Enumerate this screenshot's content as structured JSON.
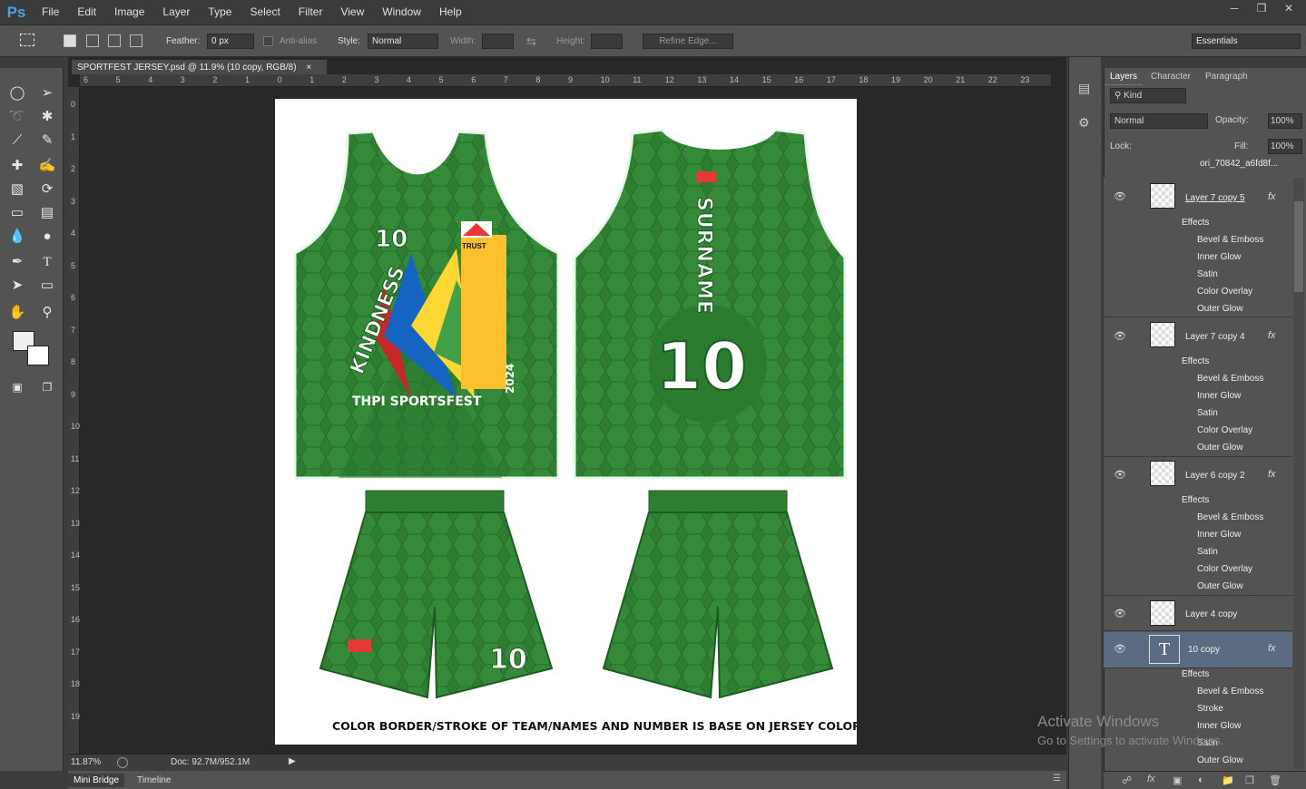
{
  "app": {
    "logo": "Ps"
  },
  "menu": [
    "File",
    "Edit",
    "Image",
    "Layer",
    "Type",
    "Select",
    "Filter",
    "View",
    "Window",
    "Help"
  ],
  "window_controls": [
    "minimize",
    "restore",
    "close"
  ],
  "options": {
    "feather_label": "Feather:",
    "feather_value": "0 px",
    "antialias_label": "Anti-alias",
    "style_label": "Style:",
    "style_value": "Normal",
    "width_label": "Width:",
    "height_label": "Height:",
    "refine_label": "Refine Edge...",
    "workspace": "Essentials"
  },
  "document": {
    "tab_title": "SPORTFEST JERSEY.psd @ 11.9% (10 copy, RGB/8)",
    "zoom": "11.87%",
    "doc_size": "Doc: 92.7M/952.1M",
    "ruler_h": [
      "6",
      "5",
      "4",
      "3",
      "2",
      "1",
      "0",
      "1",
      "2",
      "3",
      "4",
      "5",
      "6",
      "7",
      "8",
      "9",
      "10",
      "11",
      "12",
      "13",
      "14",
      "15",
      "16",
      "17",
      "18",
      "19",
      "20",
      "21",
      "22",
      "23"
    ],
    "ruler_v": [
      "0",
      "1",
      "2",
      "3",
      "4",
      "5",
      "6",
      "7",
      "8",
      "9",
      "10",
      "11",
      "12",
      "13",
      "14",
      "15",
      "16",
      "17",
      "18",
      "19"
    ]
  },
  "artwork": {
    "front_number": "10",
    "logo_text": "TRUST",
    "kindness": "KINDNESS",
    "event": "THPI SPORTSFEST",
    "year": "2024",
    "surname": "SURNAME",
    "back_number": "10",
    "shorts_number": "10",
    "footer_note": "COLOR BORDER/STROKE OF TEAM/NAMES AND NUMBER IS BASE ON JERSEY COLOR",
    "jersey_color": "#2e7d32",
    "jersey_dark": "#1f5e23"
  },
  "bottom_tabs": [
    "Mini Bridge",
    "Timeline"
  ],
  "panel": {
    "tabs": [
      "Layers",
      "Character",
      "Paragraph"
    ],
    "filter_kind": "Kind",
    "blend_mode": "Normal",
    "opacity_label": "Opacity:",
    "opacity_value": "100%",
    "lock_label": "Lock:",
    "fill_label": "Fill:",
    "fill_value": "100%",
    "top_partial_layer": "ori_70842_a6fd8f...",
    "layers": [
      {
        "name": "Layer 7 copy 5",
        "effects": [
          "Bevel & Emboss",
          "Inner Glow",
          "Satin",
          "Color Overlay",
          "Outer Glow"
        ]
      },
      {
        "name": "Layer 7 copy 4",
        "effects": [
          "Bevel & Emboss",
          "Inner Glow",
          "Satin",
          "Color Overlay",
          "Outer Glow"
        ]
      },
      {
        "name": "Layer 6 copy 2",
        "effects": [
          "Bevel & Emboss",
          "Inner Glow",
          "Satin",
          "Color Overlay",
          "Outer Glow"
        ]
      },
      {
        "name": "Layer 4 copy",
        "effects": []
      },
      {
        "name": "10 copy",
        "effects": [
          "Bevel & Emboss",
          "Stroke",
          "Inner Glow",
          "Satin",
          "Outer Glow"
        ]
      }
    ],
    "effects_label": "Effects"
  },
  "watermark": {
    "line1": "Activate Windows",
    "line2": "Go to Settings to activate Windows."
  }
}
